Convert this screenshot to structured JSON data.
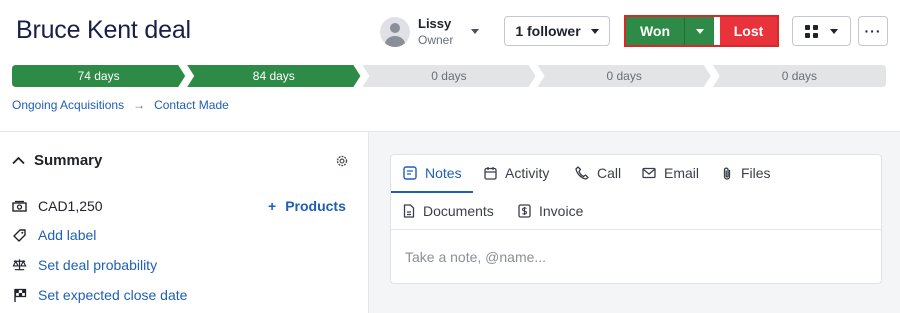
{
  "deal": {
    "title": "Bruce Kent deal"
  },
  "owner": {
    "name": "Lissy",
    "role": "Owner"
  },
  "header": {
    "follower_label": "1 follower",
    "won_label": "Won",
    "lost_label": "Lost",
    "more_label": "···"
  },
  "colors": {
    "stage_done": "#2e8b47",
    "stage_todo": "#e3e4e6",
    "won": "#2e8b47",
    "lost": "#e8333c",
    "highlight_border": "#d8282a",
    "link": "#1f5fb5"
  },
  "pipeline": {
    "stages": [
      {
        "label": "74 days",
        "done": true
      },
      {
        "label": "84 days",
        "done": true
      },
      {
        "label": "0 days",
        "done": false
      },
      {
        "label": "0 days",
        "done": false
      },
      {
        "label": "0 days",
        "done": false
      }
    ]
  },
  "breadcrumb": {
    "pipeline": "Ongoing Acquisitions",
    "separator": "→",
    "stage": "Contact Made"
  },
  "summary": {
    "title": "Summary",
    "value": "CAD1,250",
    "products_label": "Products",
    "add_label": "Add label",
    "set_probability": "Set deal probability",
    "set_close_date": "Set expected close date"
  },
  "tabs": [
    {
      "label": "Notes",
      "icon": "notes-icon",
      "active": true
    },
    {
      "label": "Activity",
      "icon": "calendar-icon",
      "active": false
    },
    {
      "label": "Call",
      "icon": "phone-icon",
      "active": false
    },
    {
      "label": "Email",
      "icon": "envelope-icon",
      "active": false
    },
    {
      "label": "Files",
      "icon": "paperclip-icon",
      "active": false
    },
    {
      "label": "Documents",
      "icon": "document-icon",
      "active": false
    },
    {
      "label": "Invoice",
      "icon": "invoice-icon",
      "active": false
    }
  ],
  "note": {
    "placeholder": "Take a note, @name..."
  }
}
